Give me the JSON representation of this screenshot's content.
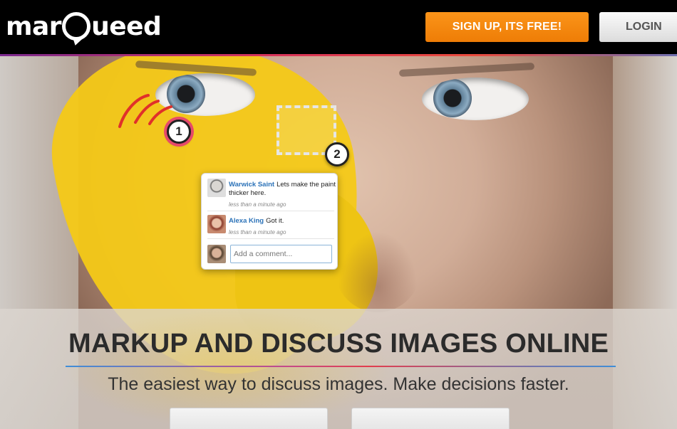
{
  "header": {
    "logo_text_pre": "mar",
    "logo_text_mid": "Q",
    "logo_text_post": "ueed",
    "signup_label": "SIGN UP,  ITS FREE!",
    "login_label": "LOGIN"
  },
  "annotations": {
    "marker_1": "1",
    "marker_2": "2"
  },
  "comments": [
    {
      "author": "Warwick Saint",
      "text": "Lets make the paint thicker here.",
      "time": "less than a minute ago",
      "avatar": "avatar-photo"
    },
    {
      "author": "Alexa King",
      "text": "Got it.",
      "time": "less than a minute ago",
      "avatar": "avatar-photo"
    }
  ],
  "comment_input": {
    "placeholder": "Add a comment..."
  },
  "hero": {
    "headline": "MARKUP AND DISCUSS IMAGES ONLINE",
    "tagline": "The easiest way to discuss images. Make decisions faster."
  },
  "colors": {
    "signup_orange": "#f38a0c",
    "link_blue": "#2b72b8",
    "paint_yellow": "#f4c917",
    "marker_ring": "#e64a6a"
  }
}
